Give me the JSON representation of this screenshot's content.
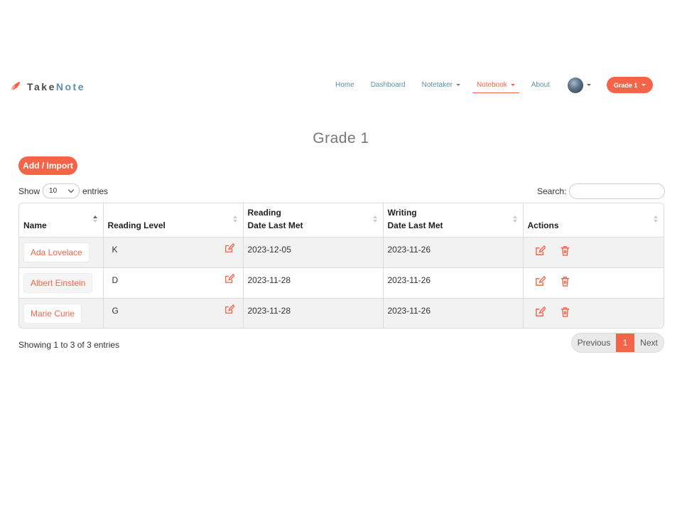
{
  "brand": {
    "take": "Take",
    "note": "Note"
  },
  "nav": {
    "items": [
      {
        "label": "Home"
      },
      {
        "label": "Dashboard"
      },
      {
        "label": "Notetaker"
      },
      {
        "label": "Notebook"
      },
      {
        "label": "About"
      }
    ],
    "grade_button": "Grade 1"
  },
  "page_title": "Grade 1",
  "add_button": "Add / Import",
  "length": {
    "show": "Show",
    "value": "10",
    "entries": "entries"
  },
  "search": {
    "label": "Search:",
    "value": ""
  },
  "table": {
    "headers": {
      "name": "Name",
      "reading_level": "Reading Level",
      "reading_line1": "Reading",
      "reading_line2": "Date Last Met",
      "writing_line1": "Writing",
      "writing_line2": "Date Last Met",
      "actions": "Actions"
    },
    "rows": [
      {
        "name": "Ada Lovelace",
        "level": "K",
        "reading": "2023-12-05",
        "writing": "2023-11-26"
      },
      {
        "name": "Albert Einstein",
        "level": "D",
        "reading": "2023-11-28",
        "writing": "2023-11-26"
      },
      {
        "name": "Marie Curie",
        "level": "G",
        "reading": "2023-11-28",
        "writing": "2023-11-26"
      }
    ]
  },
  "info": "Showing 1 to 3 of 3 entries",
  "pagination": {
    "previous": "Previous",
    "current": "1",
    "next": "Next"
  },
  "colors": {
    "accent": "#f56448",
    "nav_link": "#5b8fa8"
  }
}
